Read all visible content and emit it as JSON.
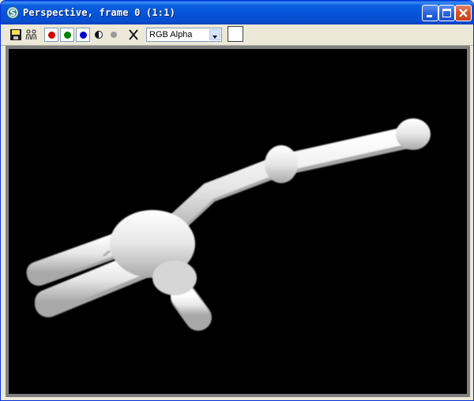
{
  "window": {
    "title": "Perspective, frame 0 (1:1)",
    "app_icon": "3dsmax-icon"
  },
  "title_buttons": [
    "minimize-icon",
    "maximize-icon",
    "close-icon"
  ],
  "toolbar": {
    "tools": [
      "save-icon",
      "clone-icon",
      "red-channel-icon",
      "green-channel-icon",
      "blue-channel-icon",
      "monochrome-icon",
      "alpha-channel-icon",
      "clear-icon"
    ],
    "channel_colors": {
      "red": "#d40000",
      "green": "#008000",
      "blue": "#0000cc"
    },
    "channel_select": {
      "value": "RGB Alpha"
    },
    "swatch_color": "#ffffff"
  },
  "colors": {
    "titlebar": "#0553d6",
    "viewport_background": "#000000",
    "window_background": "#ece9d8"
  }
}
